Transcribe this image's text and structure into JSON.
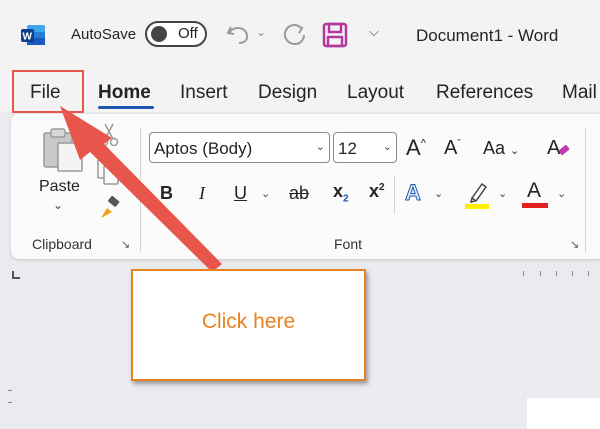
{
  "titlebar": {
    "autosave_label": "AutoSave",
    "autosave_state": "Off",
    "doc_title": "Document1  -  Word",
    "icons": [
      "word-logo-icon",
      "undo-icon",
      "redo-icon",
      "save-icon",
      "customize-qat-icon"
    ]
  },
  "tabs": [
    "File",
    "Home",
    "Insert",
    "Design",
    "Layout",
    "References",
    "Mail"
  ],
  "ribbon": {
    "clipboard": {
      "paste_label": "Paste",
      "group_label": "Clipboard"
    },
    "font": {
      "font_name": "Aptos (Body)",
      "font_size": "12",
      "case_label": "Aa",
      "group_label": "Font",
      "bold": "B",
      "italic": "I",
      "underline": "U",
      "strike": "ab",
      "subscript_base": "x",
      "subscript_mark": "2",
      "superscript_base": "x",
      "superscript_mark": "2",
      "grow": "A",
      "shrink": "A",
      "effects": "A",
      "font_color": "A"
    }
  },
  "callout": {
    "text": "Click here"
  },
  "colors": {
    "accent": "#1e56b0",
    "highlight_box": "#e8564b",
    "callout": "#e8811f",
    "highlight_yellow": "#ffef00",
    "font_red": "#e02020"
  }
}
